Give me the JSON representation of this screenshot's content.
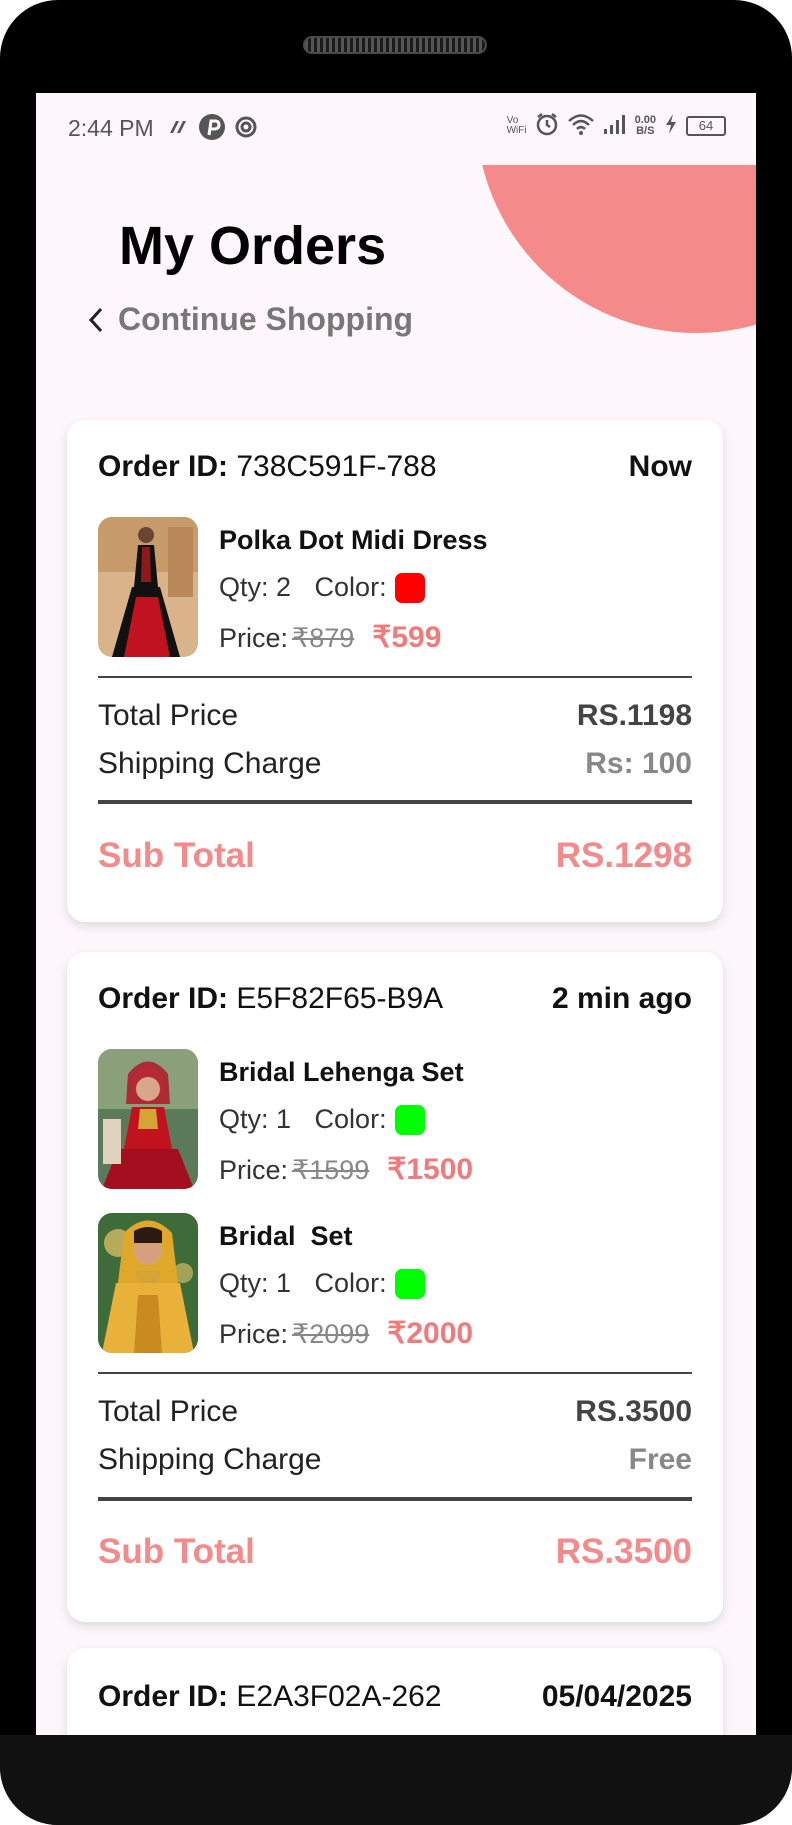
{
  "status_bar": {
    "time": "2:44 PM",
    "net_speed": "0.00",
    "net_unit": "B/S",
    "volte": "Vo",
    "wifi_label": "WiFi",
    "battery": "64"
  },
  "header": {
    "title": "My Orders",
    "back_label": "Continue Shopping"
  },
  "orders": [
    {
      "id_label": "Order ID:",
      "id": "738C591F-788",
      "time": "Now",
      "items": [
        {
          "name": "Polka Dot Midi Dress",
          "qty_label": "Qty: 2",
          "color_label": "Color:",
          "color": "#ff0000",
          "price_label": "Price:",
          "old_price": "₹879",
          "new_price": "₹599"
        }
      ],
      "total_label": "Total Price",
      "total": "RS.1198",
      "shipping_label": "Shipping Charge",
      "shipping": "Rs: 100",
      "subtotal_label": "Sub Total",
      "subtotal": "RS.1298"
    },
    {
      "id_label": "Order ID:",
      "id": "E5F82F65-B9A",
      "time": "2 min ago",
      "items": [
        {
          "name": "Bridal Lehenga Set",
          "qty_label": "Qty: 1",
          "color_label": "Color:",
          "color": "#00ff00",
          "price_label": "Price:",
          "old_price": "₹1599",
          "new_price": "₹1500"
        },
        {
          "name": "Bridal  Set",
          "qty_label": "Qty: 1",
          "color_label": "Color:",
          "color": "#00ff00",
          "price_label": "Price:",
          "old_price": "₹2099",
          "new_price": "₹2000"
        }
      ],
      "total_label": "Total Price",
      "total": "RS.3500",
      "shipping_label": "Shipping Charge",
      "shipping": "Free",
      "subtotal_label": "Sub Total",
      "subtotal": "RS.3500"
    },
    {
      "id_label": "Order ID:",
      "id": "E2A3F02A-262",
      "time": "05/04/2025"
    }
  ],
  "colors": {
    "accent": "#f48a8a",
    "background": "#fdf7fb"
  }
}
